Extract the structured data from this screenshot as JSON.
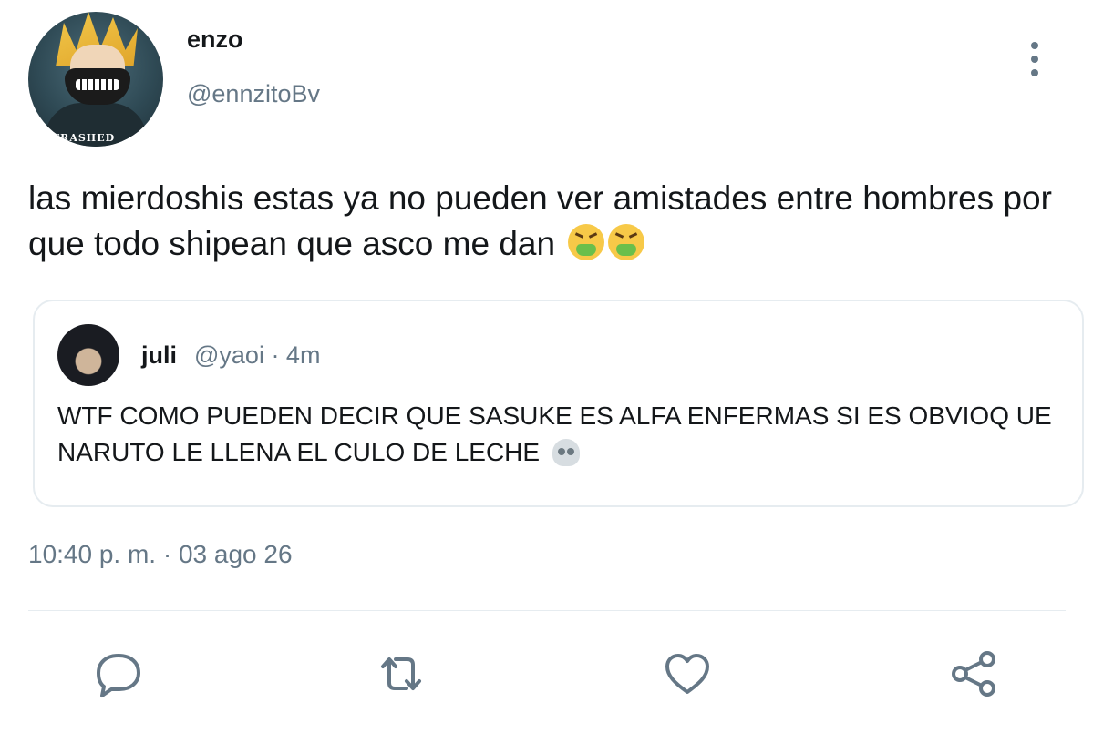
{
  "author": {
    "display_name": "enzo",
    "handle": "@ennzitoBv",
    "avatar_tag": "TRASHED"
  },
  "tweet": {
    "text": "las mierdoshis estas ya no pueden ver amistades entre hombres por que todo shipean que asco me dan",
    "trailing_emojis": [
      "nauseated-face",
      "nauseated-face"
    ]
  },
  "quoted_tweet": {
    "display_name": "juli",
    "meta": "@yaoi · 4m",
    "text": "WTF COMO PUEDEN DECIR QUE SASUKE ES ALFA ENFERMAS SI ES OBVIOQ UE NARUTO LE LLENA EL CULO DE LECHE",
    "trailing_emoji": "skull"
  },
  "timestamp": "10:40 p. m. · 03 ago 26",
  "actions": [
    "reply-icon",
    "retweet-icon",
    "like-icon",
    "share-icon"
  ],
  "colors": {
    "text": "#14171a",
    "secondary": "#657786",
    "border": "#e6ecf0",
    "icon": "#657786"
  }
}
